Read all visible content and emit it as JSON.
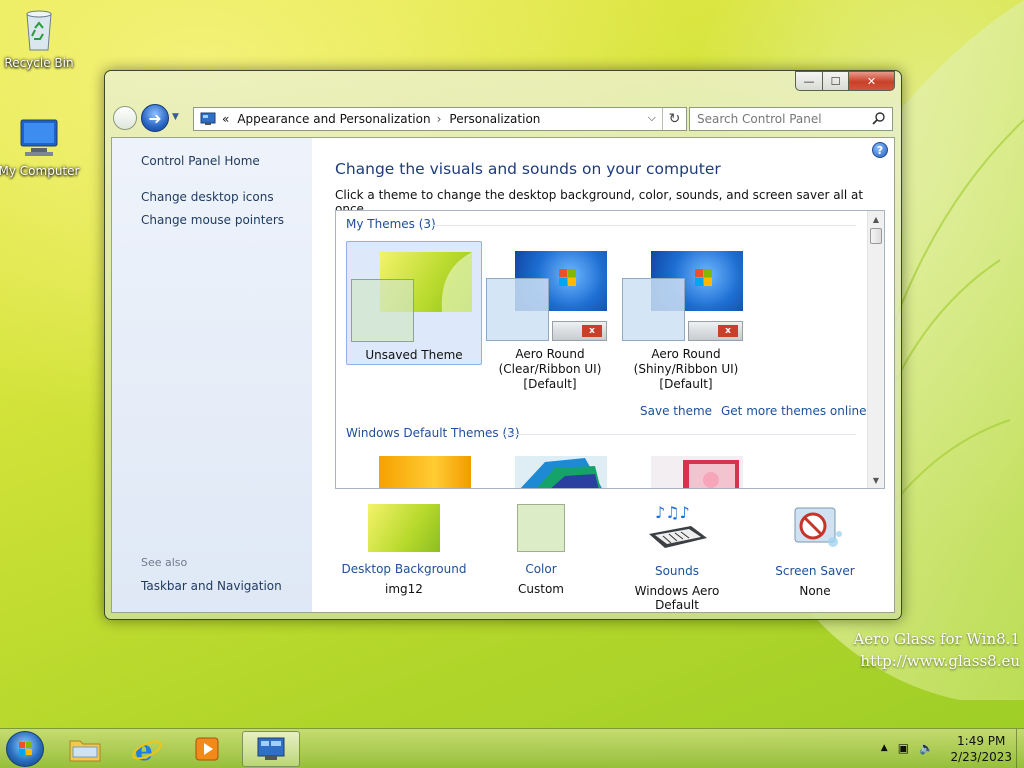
{
  "desktop": {
    "icons": [
      {
        "label": "Recycle Bin",
        "icon": "recycle-bin-icon"
      },
      {
        "label": "My Computer",
        "icon": "computer-icon"
      }
    ],
    "watermark": {
      "line1": "Aero Glass for Win8.1",
      "line2": "http://www.glass8.eu"
    }
  },
  "window": {
    "controls": {
      "minimize": "—",
      "maximize": "☐",
      "close": "✕"
    },
    "nav": {
      "back_icon": "back-arrow-icon",
      "forward_icon": "forward-arrow-icon",
      "forward_glyph": "➜",
      "recent_glyph": "▼",
      "address": {
        "prefix": "«",
        "crumb1": "Appearance and Personalization",
        "sep": "›",
        "crumb2": "Personalization",
        "dropdown_glyph": "⌵",
        "refresh_glyph": "↻"
      },
      "search_placeholder": "Search Control Panel"
    },
    "sidebar": {
      "home": "Control Panel Home",
      "links": [
        "Change desktop icons",
        "Change mouse pointers"
      ],
      "see_also": "See also",
      "see_also_links": [
        "Taskbar and Navigation"
      ]
    },
    "main": {
      "help_glyph": "?",
      "title": "Change the visuals and sounds on your computer",
      "subtitle": "Click a theme to change the desktop background, color, sounds, and screen saver all at once.",
      "groups": [
        {
          "heading": "My Themes (3)",
          "themes": [
            {
              "label": "Unsaved Theme",
              "selected": true
            },
            {
              "label": "Aero Round\n(Clear/Ribbon UI)\n[Default]",
              "selected": false
            },
            {
              "label": "Aero Round\n(Shiny/Ribbon UI)\n[Default]",
              "selected": false
            }
          ],
          "links": {
            "save": "Save theme",
            "more": "Get more themes online"
          }
        },
        {
          "heading": "Windows Default Themes (3)"
        }
      ],
      "bottom": [
        {
          "link": "Desktop Background",
          "value": "img12",
          "icon": "desktop-background-icon"
        },
        {
          "link": "Color",
          "value": "Custom",
          "icon": "color-swatch-icon"
        },
        {
          "link": "Sounds",
          "value": "Windows Aero Default",
          "icon": "sounds-icon"
        },
        {
          "link": "Screen Saver",
          "value": "None",
          "icon": "screen-saver-icon"
        }
      ]
    }
  },
  "taskbar": {
    "buttons": [
      {
        "icon": "file-explorer-icon"
      },
      {
        "icon": "internet-explorer-icon"
      },
      {
        "icon": "media-player-icon"
      },
      {
        "icon": "control-panel-icon",
        "active": true
      }
    ],
    "tray": {
      "expand_glyph": "▲",
      "network_glyph": "▣",
      "volume_glyph": "🔈"
    },
    "clock": {
      "time": "1:49 PM",
      "date": "2/23/2023"
    }
  },
  "colors": {
    "link": "#1e4f9a",
    "title": "#1e3b7a",
    "selected_bg": "#dde9fb",
    "close_button": "#c8412a"
  }
}
